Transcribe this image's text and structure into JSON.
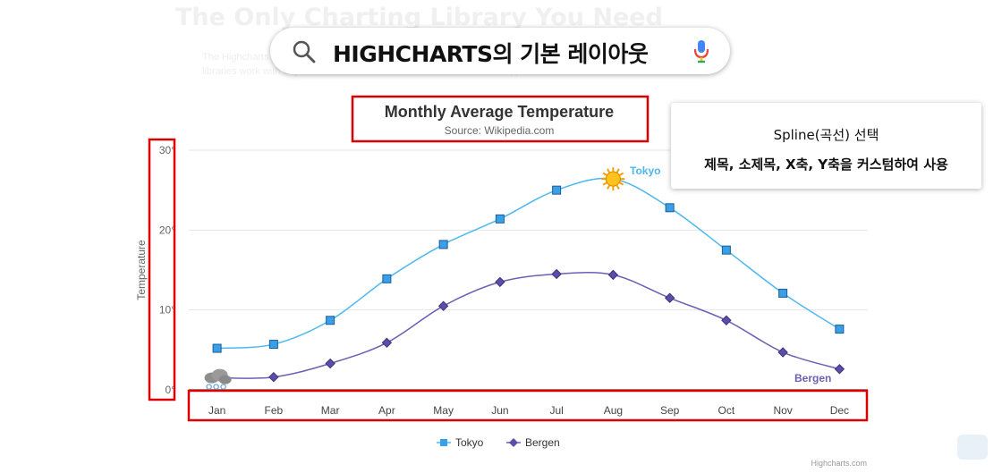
{
  "background": {
    "heading": "The Only Charting Library You Need",
    "lines": [
      "The Highcharts ... secure data visualization ...",
      "libraries work with any backend database or server stack. We offer wrappers"
    ]
  },
  "search": {
    "query": "HIGHCHARTS의 기본 레이아웃",
    "icon": "search-icon",
    "mic_icon": "microphone-icon"
  },
  "note": {
    "line1": "Spline(곡선) 선택",
    "line2": "제목, 소제목, X축, Y축을 커스텀하여 사용"
  },
  "highlight_color": "#dd0000",
  "chart_data": {
    "type": "line",
    "curve": "spline",
    "title": "Monthly Average Temperature",
    "subtitle": "Source: Wikipedia.com",
    "ylabel": "Temperature",
    "xlabel": "",
    "categories": [
      "Jan",
      "Feb",
      "Mar",
      "Apr",
      "May",
      "Jun",
      "Jul",
      "Aug",
      "Sep",
      "Oct",
      "Nov",
      "Dec"
    ],
    "yticks": [
      "0°",
      "10°",
      "20°",
      "30°"
    ],
    "ylim": [
      0,
      30
    ],
    "grid": true,
    "legend_position": "bottom",
    "credits": "Highcharts.com",
    "series": [
      {
        "name": "Tokyo",
        "color": "#4db8f0",
        "marker": "square",
        "end_label": "Tokyo",
        "values": [
          5.2,
          5.7,
          8.7,
          13.9,
          18.2,
          21.4,
          25.0,
          26.4,
          22.8,
          17.5,
          12.1,
          7.6
        ],
        "marker_icon": {
          "index": 7,
          "icon": "sun-icon"
        }
      },
      {
        "name": "Bergen",
        "color": "#6c5fb5",
        "marker": "diamond",
        "end_label": "Bergen",
        "values": [
          1.5,
          1.6,
          3.3,
          5.9,
          10.5,
          13.5,
          14.5,
          14.4,
          11.5,
          8.7,
          4.7,
          2.6
        ],
        "marker_icon": {
          "index": 0,
          "icon": "snow-cloud-icon"
        }
      }
    ]
  }
}
